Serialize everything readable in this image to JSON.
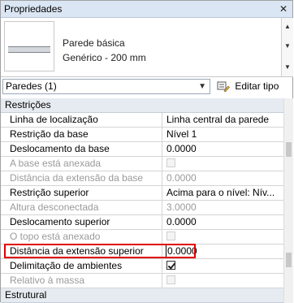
{
  "window": {
    "title": "Propriedades",
    "close_glyph": "✕"
  },
  "type_selector": {
    "line1": "Parede básica",
    "line2": "Genérico - 200 mm"
  },
  "instance_selector": {
    "value": "Paredes (1)",
    "edit_type_label": "Editar tipo"
  },
  "groups": {
    "restricoes": "Restrições",
    "estrutural": "Estrutural"
  },
  "rows": [
    {
      "name": "Linha de localização",
      "value": "Linha central da parede",
      "disabled": false
    },
    {
      "name": "Restrição da base",
      "value": "Nível 1",
      "disabled": false
    },
    {
      "name": "Deslocamento da base",
      "value": "0.0000",
      "disabled": false
    },
    {
      "name": "A base está anexada",
      "value": "",
      "disabled": true
    },
    {
      "name": "Distância da extensão da base",
      "value": "0.0000",
      "disabled": true
    },
    {
      "name": "Restrição superior",
      "value": "Acima para o nível: Nív...",
      "disabled": false
    },
    {
      "name": "Altura desconectada",
      "value": "3.0000",
      "disabled": true
    },
    {
      "name": "Deslocamento superior",
      "value": "0.0000",
      "disabled": false
    },
    {
      "name": "O topo está anexado",
      "value": "",
      "disabled": true
    },
    {
      "name": "Distância da extensão superior",
      "value": "0.0000",
      "disabled": false
    },
    {
      "name": "Delimitação de ambientes",
      "value": "",
      "disabled": false
    },
    {
      "name": "Relativo à massa",
      "value": "",
      "disabled": true
    }
  ],
  "colors": {
    "highlight": "#e00000",
    "group_bg": "#e6ebf1",
    "titlebar_bg": "#dbe6f4"
  }
}
